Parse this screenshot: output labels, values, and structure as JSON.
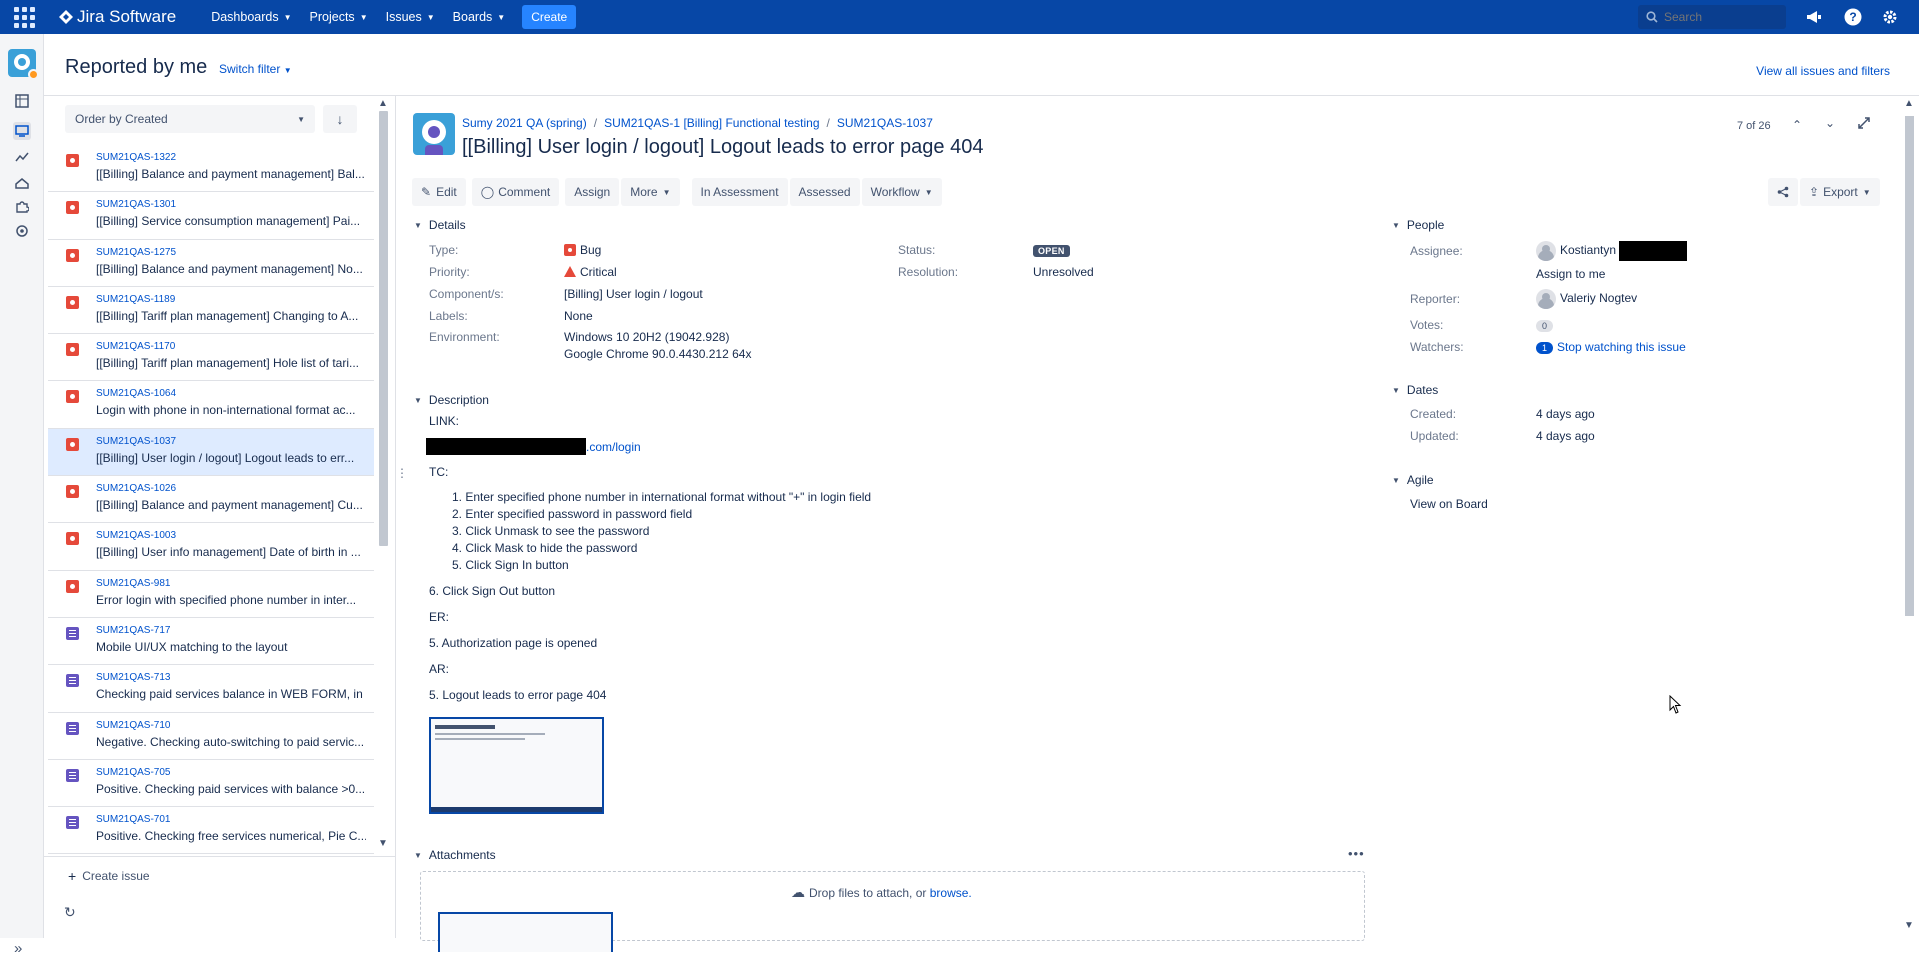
{
  "topnav": {
    "product": "Jira Software",
    "menus": [
      {
        "label": "Dashboards"
      },
      {
        "label": "Projects"
      },
      {
        "label": "Issues"
      },
      {
        "label": "Boards"
      }
    ],
    "create_label": "Create",
    "search_placeholder": "Search"
  },
  "header": {
    "title": "Reported by me",
    "switch_filter": "Switch filter",
    "view_all": "View all issues and filters"
  },
  "list": {
    "order_by": "Order by Created",
    "create_issue": "Create issue",
    "items": [
      {
        "key": "SUM21QAS-1322",
        "summary": "[[Billing] Balance and payment management] Bal...",
        "type": "bug"
      },
      {
        "key": "SUM21QAS-1301",
        "summary": "[[Billing] Service consumption management] Pai...",
        "type": "bug"
      },
      {
        "key": "SUM21QAS-1275",
        "summary": "[[Billing] Balance and payment management] No...",
        "type": "bug"
      },
      {
        "key": "SUM21QAS-1189",
        "summary": "[[Billing] Tariff plan management] Changing to A...",
        "type": "bug"
      },
      {
        "key": "SUM21QAS-1170",
        "summary": "[[Billing] Tariff plan management] Hole list of tari...",
        "type": "bug"
      },
      {
        "key": "SUM21QAS-1064",
        "summary": "Login with phone in non-international format ac...",
        "type": "bug"
      },
      {
        "key": "SUM21QAS-1037",
        "summary": "[[Billing] User login / logout] Logout leads to err...",
        "type": "bug",
        "selected": true
      },
      {
        "key": "SUM21QAS-1026",
        "summary": "[[Billing] Balance and payment management] Cu...",
        "type": "bug"
      },
      {
        "key": "SUM21QAS-1003",
        "summary": "[[Billing] User info management] Date of birth in ...",
        "type": "bug"
      },
      {
        "key": "SUM21QAS-981",
        "summary": "Error login with specified phone number in inter...",
        "type": "bug"
      },
      {
        "key": "SUM21QAS-717",
        "summary": "Mobile UI/UX matching to the layout",
        "type": "story"
      },
      {
        "key": "SUM21QAS-713",
        "summary": "Checking paid services balance in WEB FORM, in ...",
        "type": "story"
      },
      {
        "key": "SUM21QAS-710",
        "summary": "Negative. Checking auto-switching to paid servic...",
        "type": "story"
      },
      {
        "key": "SUM21QAS-705",
        "summary": "Positive. Checking paid services with balance >0....",
        "type": "story"
      },
      {
        "key": "SUM21QAS-701",
        "summary": "Positive. Checking free services numerical, Pie C...",
        "type": "story"
      }
    ]
  },
  "issue": {
    "breadcrumbs": [
      "Sumy 2021 QA (spring)",
      "SUM21QAS-1 [Billing] Functional testing",
      "SUM21QAS-1037"
    ],
    "title": "[[Billing] User login / logout] Logout leads to error page 404",
    "pager": "7 of 26",
    "toolbar": {
      "edit": "Edit",
      "comment": "Comment",
      "assign": "Assign",
      "more": "More",
      "in_assessment": "In Assessment",
      "assessed": "Assessed",
      "workflow": "Workflow",
      "export": "Export"
    },
    "details": {
      "section": "Details",
      "type_label": "Type:",
      "type": "Bug",
      "priority_label": "Priority:",
      "priority": "Critical",
      "components_label": "Component/s:",
      "components": "[Billing] User login / logout",
      "labels_label": "Labels:",
      "labels": "None",
      "environment_label": "Environment:",
      "environment_1": "Windows 10 20H2 (19042.928)",
      "environment_2": "Google Chrome 90.0.4430.212 64x",
      "status_label": "Status:",
      "status": "OPEN",
      "resolution_label": "Resolution:",
      "resolution": "Unresolved"
    },
    "description": {
      "section": "Description",
      "link_label": "LINK:",
      "link_suffix": ".com/login",
      "tc_label": "TC:",
      "steps": [
        "Enter specified phone number in international format without \"+\" in login field",
        "Enter specified password in password field",
        "Click Unmask to see the password",
        "Click Mask to hide the password",
        "Click Sign In button"
      ],
      "step6": "6. Click Sign Out button",
      "er_label": "ER:",
      "er": "5. Authorization page is opened",
      "ar_label": "AR:",
      "ar": "5. Logout leads to error page 404"
    },
    "people": {
      "section": "People",
      "assignee_label": "Assignee:",
      "assignee": "Kostiantyn",
      "assign_to_me": "Assign to me",
      "reporter_label": "Reporter:",
      "reporter": "Valeriy Nogtev",
      "votes_label": "Votes:",
      "votes": "0",
      "watchers_label": "Watchers:",
      "watchers": "1",
      "stop_watching": "Stop watching this issue"
    },
    "dates": {
      "section": "Dates",
      "created_label": "Created:",
      "created": "4 days ago",
      "updated_label": "Updated:",
      "updated": "4 days ago"
    },
    "agile": {
      "section": "Agile",
      "view_on_board": "View on Board"
    },
    "attachments": {
      "section": "Attachments",
      "drop_text": "Drop files to attach, or",
      "browse": "browse."
    }
  }
}
